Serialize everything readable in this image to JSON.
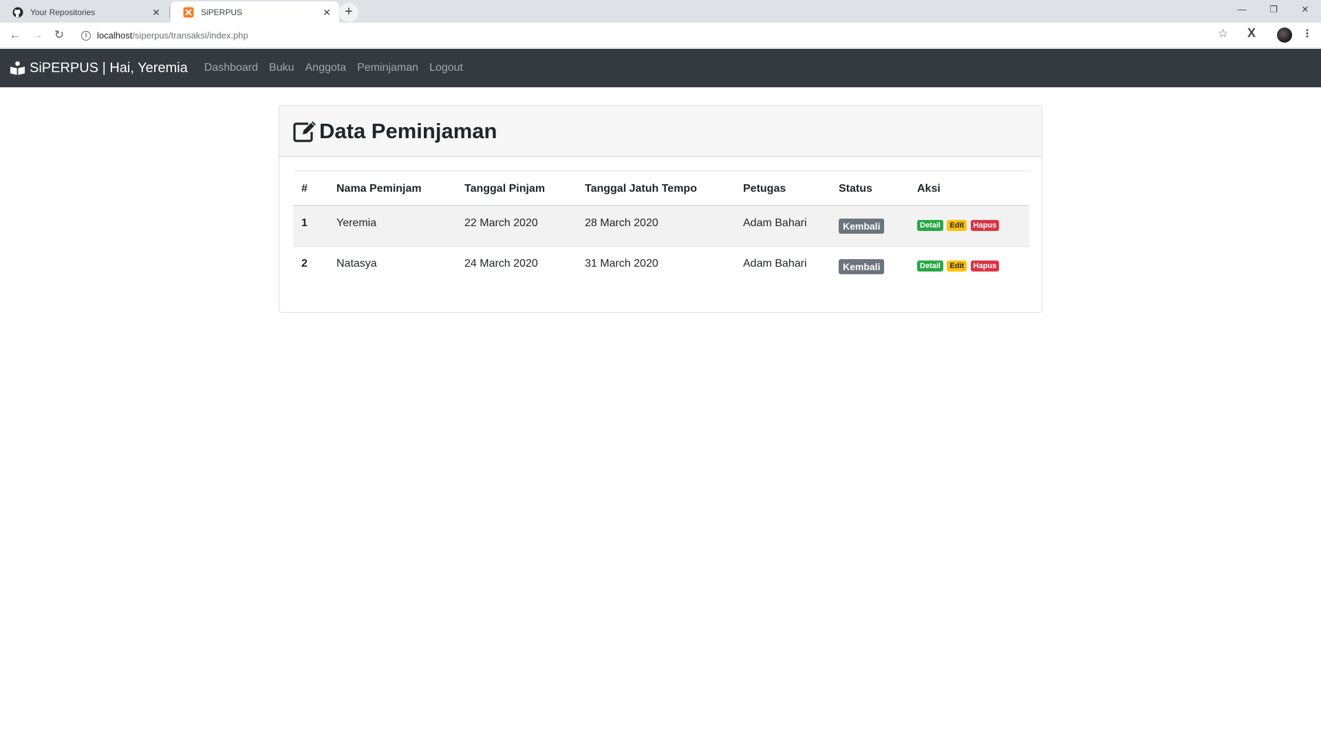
{
  "browser": {
    "tabs": [
      {
        "title": "Your Repositories",
        "icon": "github-icon"
      },
      {
        "title": "SiPERPUS",
        "icon": "xampp-icon"
      }
    ],
    "url_host": "localhost",
    "url_path": "/siperpus/transaksi/index.php"
  },
  "navbar": {
    "brand": "SiPERPUS | Hai, Yeremia",
    "links": [
      "Dashboard",
      "Buku",
      "Anggota",
      "Peminjaman",
      "Logout"
    ]
  },
  "card": {
    "title": "Data Peminjaman"
  },
  "table": {
    "columns": [
      "#",
      "Nama Peminjam",
      "Tanggal Pinjam",
      "Tanggal Jatuh Tempo",
      "Petugas",
      "Status",
      "Aksi"
    ],
    "rows": [
      {
        "no": "1",
        "nama": "Yeremia",
        "tgl_pinjam": "22 March 2020",
        "tgl_tempo": "28 March 2020",
        "petugas": "Adam Bahari",
        "status": "Kembali",
        "actions": [
          "Detail",
          "Edit",
          "Hapus"
        ]
      },
      {
        "no": "2",
        "nama": "Natasya",
        "tgl_pinjam": "24 March 2020",
        "tgl_tempo": "31 March 2020",
        "petugas": "Adam Bahari",
        "status": "Kembali",
        "actions": [
          "Detail",
          "Edit",
          "Hapus"
        ]
      }
    ]
  },
  "colors": {
    "navbar_bg": "#343a40",
    "status_badge": "#6c757d",
    "detail_badge": "#28a745",
    "edit_badge": "#ffc107",
    "hapus_badge": "#dc3545"
  }
}
